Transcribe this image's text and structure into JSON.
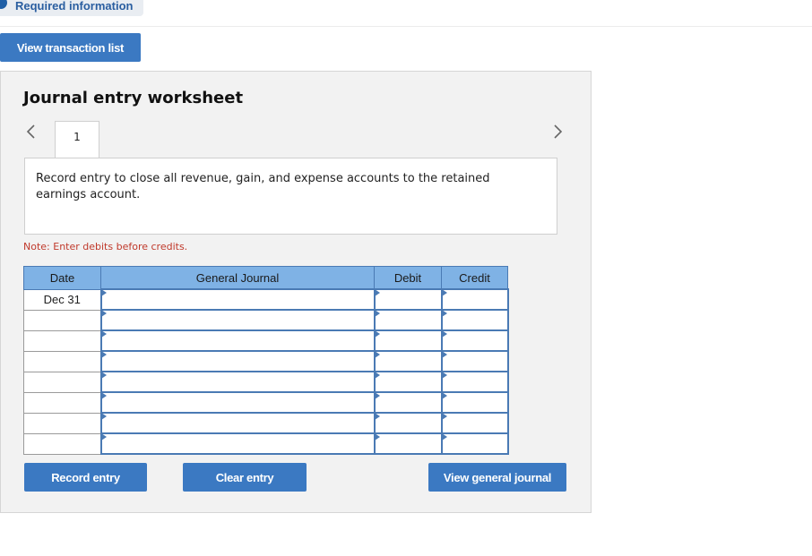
{
  "header": {
    "required_tab_label": "Required information"
  },
  "toolbar": {
    "view_transaction_list": "View transaction list"
  },
  "worksheet": {
    "title": "Journal entry worksheet",
    "active_tab": "1",
    "instruction": "Record entry to close all revenue, gain, and expense accounts to the retained earnings account.",
    "note": "Note: Enter debits before credits."
  },
  "table": {
    "headers": {
      "date": "Date",
      "general_journal": "General Journal",
      "debit": "Debit",
      "credit": "Credit"
    },
    "rows": [
      {
        "date": "Dec 31",
        "account": "",
        "debit": "",
        "credit": ""
      },
      {
        "date": "",
        "account": "",
        "debit": "",
        "credit": ""
      },
      {
        "date": "",
        "account": "",
        "debit": "",
        "credit": ""
      },
      {
        "date": "",
        "account": "",
        "debit": "",
        "credit": ""
      },
      {
        "date": "",
        "account": "",
        "debit": "",
        "credit": ""
      },
      {
        "date": "",
        "account": "",
        "debit": "",
        "credit": ""
      },
      {
        "date": "",
        "account": "",
        "debit": "",
        "credit": ""
      },
      {
        "date": "",
        "account": "",
        "debit": "",
        "credit": ""
      }
    ]
  },
  "actions": {
    "record_entry": "Record entry",
    "clear_entry": "Clear entry",
    "view_general_journal": "View general journal"
  },
  "colors": {
    "button": "#3b79c2",
    "header_fill": "#7fb2e5",
    "note_red": "#c0392b"
  }
}
